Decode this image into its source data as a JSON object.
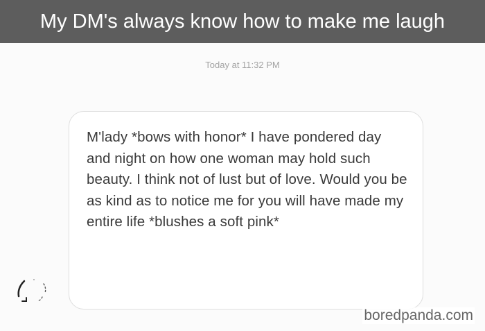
{
  "caption": {
    "title": "My DM's always know how to make me laugh"
  },
  "conversation": {
    "timestamp": "Today at 11:32 PM",
    "messages": [
      {
        "text": "M'lady *bows with honor* I have pondered day and night on how one woman may hold such beauty. I think not of lust but of love. Would you be as kind as to notice me for you will have made my entire life *blushes a soft pink*"
      }
    ],
    "sender_avatar_icon": "avatar-icon"
  },
  "watermark": {
    "text": "boredpanda.com"
  }
}
